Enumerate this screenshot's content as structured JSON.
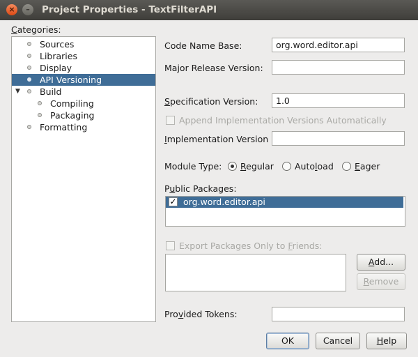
{
  "window": {
    "title": "Project Properties - TextFilterAPI"
  },
  "categories": {
    "label_ul": "C",
    "label_rest": "ategories:",
    "items": [
      {
        "label": "Sources"
      },
      {
        "label": "Libraries"
      },
      {
        "label": "Display"
      },
      {
        "label": "API Versioning",
        "selected": true
      },
      {
        "label": "Build",
        "expanded": true
      },
      {
        "label": "Compiling"
      },
      {
        "label": "Packaging"
      },
      {
        "label": "Formatting"
      }
    ]
  },
  "form": {
    "code_name_base": {
      "label": "Code Name Base:",
      "value": "org.word.editor.api"
    },
    "major_release_version": {
      "label": "Major Release Version:",
      "value": ""
    },
    "specification_version": {
      "label_ul": "S",
      "label_rest": "pecification Version:",
      "value": "1.0"
    },
    "append_impl_versions": {
      "label": "Append Implementation Versions Automatically",
      "checked": false
    },
    "implementation_version": {
      "label_ul": "I",
      "label_rest": "mplementation Version",
      "value": ""
    },
    "module_type": {
      "label": "Module Type:",
      "options": [
        {
          "pre": "",
          "ul": "R",
          "post": "egular"
        },
        {
          "pre": "Auto",
          "ul": "l",
          "post": "oad"
        },
        {
          "pre": "",
          "ul": "E",
          "post": "ager"
        }
      ],
      "selected": "Regular"
    },
    "public_packages": {
      "label_pre": "P",
      "label_ul": "u",
      "label_rest": "blic Packages:",
      "items": [
        {
          "name": "org.word.editor.api",
          "checked": true
        }
      ]
    },
    "export_friends": {
      "label_pre": "Export Packages Only to ",
      "label_ul": "F",
      "label_rest": "riends:",
      "checked": false
    },
    "add_button": {
      "ul": "A",
      "rest": "dd..."
    },
    "remove_button": {
      "ul": "R",
      "rest": "emove"
    },
    "provided_tokens": {
      "label_pre": "Pro",
      "label_ul": "v",
      "label_rest": "ided Tokens:",
      "value": ""
    }
  },
  "buttons": {
    "ok": "OK",
    "cancel": "Cancel",
    "help_ul": "H",
    "help_rest": "elp"
  }
}
